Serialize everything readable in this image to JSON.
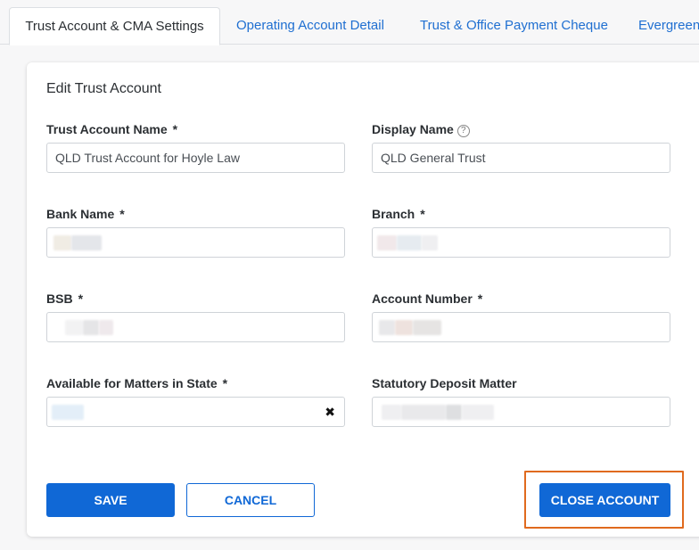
{
  "tabs": [
    {
      "label": "Trust Account & CMA Settings",
      "active": true
    },
    {
      "label": "Operating Account Detail",
      "active": false
    },
    {
      "label": "Trust & Office Payment Cheque",
      "active": false
    },
    {
      "label": "Evergreen",
      "active": false
    }
  ],
  "form": {
    "title": "Edit Trust Account",
    "required_mark": "*",
    "fields": {
      "trust_account_name": {
        "label": "Trust Account Name",
        "value": "QLD Trust Account for Hoyle Law"
      },
      "display_name": {
        "label": "Display Name",
        "value": "QLD General Trust",
        "help_icon": "?"
      },
      "bank_name": {
        "label": "Bank Name"
      },
      "branch": {
        "label": "Branch"
      },
      "bsb": {
        "label": "BSB"
      },
      "account_number": {
        "label": "Account Number"
      },
      "available_state": {
        "label": "Available for Matters in State",
        "clear_icon": "✖"
      },
      "statutory_deposit": {
        "label": "Statutory Deposit Matter"
      }
    }
  },
  "buttons": {
    "save": "SAVE",
    "cancel": "CANCEL",
    "close_account": "CLOSE ACCOUNT"
  },
  "colors": {
    "primary": "#1068d6",
    "highlight": "#e06a1e",
    "link": "#1f6fd1"
  }
}
